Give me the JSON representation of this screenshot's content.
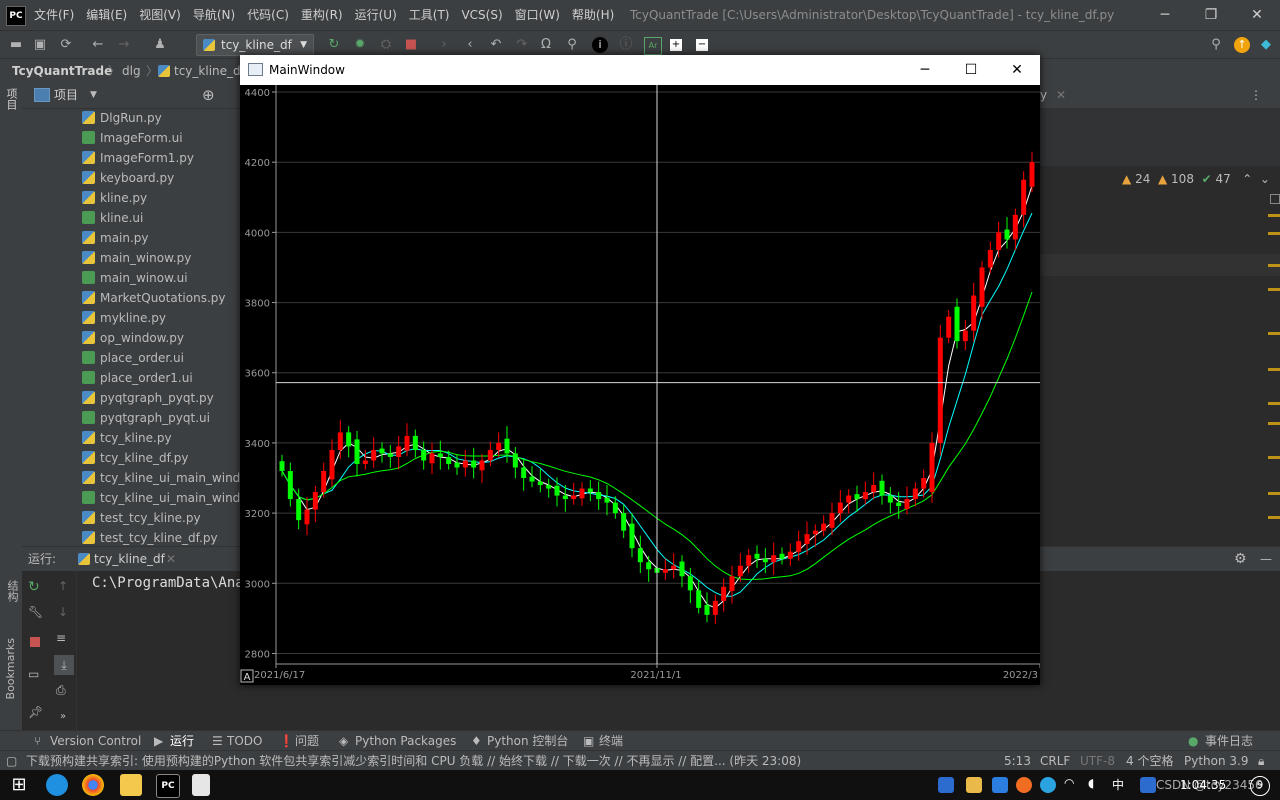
{
  "app": {
    "menu": [
      "文件(F)",
      "编辑(E)",
      "视图(V)",
      "导航(N)",
      "代码(C)",
      "重构(R)",
      "运行(U)",
      "工具(T)",
      "VCS(S)",
      "窗口(W)",
      "帮助(H)"
    ],
    "window_title": "TcyQuantTrade [C:\\Users\\Administrator\\Desktop\\TcyQuantTrade] - tcy_kline_df.py",
    "run_config": "tcy_kline_df",
    "breadcrumb": [
      "TcyQuantTrade",
      "dlg",
      "tcy_kline_df"
    ],
    "logo": "PC"
  },
  "project_panel": {
    "title": "项目",
    "files": [
      {
        "name": "DlgRun.py",
        "type": "py"
      },
      {
        "name": "ImageForm.ui",
        "type": "ui"
      },
      {
        "name": "ImageForm1.py",
        "type": "py"
      },
      {
        "name": "keyboard.py",
        "type": "py"
      },
      {
        "name": "kline.py",
        "type": "py"
      },
      {
        "name": "kline.ui",
        "type": "ui"
      },
      {
        "name": "main.py",
        "type": "py"
      },
      {
        "name": "main_winow.py",
        "type": "py"
      },
      {
        "name": "main_winow.ui",
        "type": "ui"
      },
      {
        "name": "MarketQuotations.py",
        "type": "py"
      },
      {
        "name": "mykline.py",
        "type": "py"
      },
      {
        "name": "op_window.py",
        "type": "py"
      },
      {
        "name": "place_order.ui",
        "type": "ui"
      },
      {
        "name": "place_order1.ui",
        "type": "ui"
      },
      {
        "name": "pyqtgraph_pyqt.py",
        "type": "py"
      },
      {
        "name": "pyqtgraph_pyqt.ui",
        "type": "ui"
      },
      {
        "name": "tcy_kline.py",
        "type": "py"
      },
      {
        "name": "tcy_kline_df.py",
        "type": "py"
      },
      {
        "name": "tcy_kline_ui_main_window",
        "type": "py"
      },
      {
        "name": "tcy_kline_ui_main_window",
        "type": "ui"
      },
      {
        "name": "test_tcy_kline.py",
        "type": "py"
      },
      {
        "name": "test_tcy_kline_df.py",
        "type": "py"
      }
    ]
  },
  "left_strip": {
    "project_label": "项目",
    "structure_label": "结构",
    "bookmarks_label": "Bookmarks"
  },
  "editor": {
    "tab_fragment": "y",
    "inspections": {
      "warnings": "24",
      "weak_warnings": "108",
      "ok": "47"
    }
  },
  "run_panel": {
    "label": "运行:",
    "tab": "tcy_kline_df",
    "console_line": "C:\\ProgramData\\Anaco"
  },
  "bottom_tabs": [
    "Version Control",
    "运行",
    "TODO",
    "问题",
    "Python Packages",
    "Python 控制台",
    "终端",
    "事件日志"
  ],
  "status_bar": {
    "message": "下载预构建共享索引: 使用预构建的Python 软件包共享索引减少索引时间和 CPU 负载 // 始终下载 // 下载一次 // 不再显示 // 配置... (昨天 23:08)",
    "position": "5:13",
    "line_sep": "CRLF",
    "encoding": "UTF-8",
    "indent": "4 个空格",
    "interpreter": "Python 3.9"
  },
  "taskbar": {
    "time": "1:04:35",
    "watermark": "CSDN @tcy23456",
    "ime": "中",
    "notif_count": "9"
  },
  "main_window": {
    "title": "MainWindow",
    "autorange_label": "A"
  },
  "chart_data": {
    "type": "candlestick",
    "y_ticks": [
      2800,
      3000,
      3200,
      3400,
      3600,
      3800,
      4000,
      4200,
      4400
    ],
    "x_ticks": [
      "2021/6/17",
      "2021/11/1",
      "2022/3"
    ],
    "ylim": [
      2770,
      4420
    ],
    "crosshair": {
      "date": "2021/11/1",
      "price": 3572
    },
    "grid": true,
    "up_color": "#ff0000",
    "down_color": "#00ff00",
    "ma_colors": [
      "#ffffff",
      "#00ffff",
      "#00ff00"
    ],
    "close": [
      3320,
      3240,
      3180,
      3210,
      3260,
      3320,
      3380,
      3430,
      3390,
      3340,
      3350,
      3380,
      3370,
      3360,
      3390,
      3420,
      3380,
      3350,
      3370,
      3360,
      3340,
      3330,
      3350,
      3330,
      3350,
      3380,
      3400,
      3370,
      3330,
      3300,
      3290,
      3280,
      3270,
      3250,
      3240,
      3250,
      3270,
      3260,
      3240,
      3230,
      3200,
      3150,
      3100,
      3060,
      3040,
      3030,
      3040,
      3050,
      3020,
      2980,
      2930,
      2910,
      2950,
      2990,
      3020,
      3050,
      3080,
      3070,
      3060,
      3080,
      3070,
      3090,
      3120,
      3140,
      3150,
      3170,
      3200,
      3230,
      3250,
      3240,
      3260,
      3280,
      3250,
      3230,
      3220,
      3240,
      3270,
      3300,
      3400,
      3700,
      3760,
      3690,
      3720,
      3820,
      3900,
      3950,
      4000,
      3980,
      4050,
      4150,
      4200
    ]
  }
}
